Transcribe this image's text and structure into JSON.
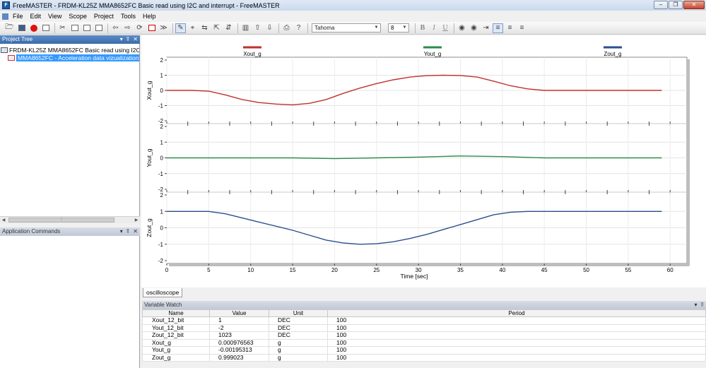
{
  "window": {
    "title": "FreeMASTER - FRDM-KL25Z MMA8652FC Basic read using I2C and interrupt - FreeMASTER",
    "app_icon_letter": "F",
    "minimize_glyph": "–",
    "restore_glyph": "❐",
    "close_glyph": "✕"
  },
  "menu": [
    "File",
    "Edit",
    "View",
    "Scope",
    "Project",
    "Tools",
    "Help"
  ],
  "toolbar": {
    "font_name": "Tahoma",
    "font_size": "8",
    "bold": "B",
    "italic": "I",
    "underline": "U"
  },
  "project_tree": {
    "title": "Project Tree",
    "header_buttons": [
      "▾",
      "⫪",
      "✕"
    ],
    "root": "FRDM-KL25Z MMA8652FC Basic read using I2C and interrupt",
    "child": "MMA8652FC - Acceleration data vizualization"
  },
  "app_commands": {
    "title": "Application Commands",
    "header_buttons": [
      "▾",
      "⫪",
      "✕"
    ]
  },
  "scope": {
    "tab_label": "oscilloscope",
    "x_label": "Time [sec]",
    "x_ticks": [
      "0",
      "5",
      "10",
      "15",
      "20",
      "25",
      "30",
      "35",
      "40",
      "45",
      "50",
      "55",
      "60"
    ],
    "legend": [
      {
        "name": "Xout_g",
        "color": "#c0312b"
      },
      {
        "name": "Yout_g",
        "color": "#2e8b4a"
      },
      {
        "name": "Zout_g",
        "color": "#2b4f8f"
      }
    ],
    "subplots": [
      {
        "ylabel": "Xout_g",
        "y_ticks": [
          "2",
          "1",
          "0",
          "-1",
          "-2"
        ],
        "color": "#c0312b"
      },
      {
        "ylabel": "Yout_g",
        "y_ticks": [
          "2",
          "1",
          "0",
          "-1",
          "-2"
        ],
        "color": "#2e8b4a"
      },
      {
        "ylabel": "Zout_g",
        "y_ticks": [
          "2",
          "1",
          "0",
          "-1",
          "-2"
        ],
        "color": "#2b4f8f"
      }
    ]
  },
  "chart_data": {
    "type": "line",
    "xlabel": "Time [sec]",
    "xlim": [
      0,
      62
    ],
    "ylim": [
      -2,
      2
    ],
    "grid": true,
    "legend_position": "top",
    "series": [
      {
        "name": "Xout_g",
        "color": "#c0312b",
        "x": [
          0,
          3,
          5,
          7,
          9,
          11,
          13,
          15,
          17,
          19,
          21,
          23,
          25,
          27,
          29,
          31,
          33,
          35,
          37,
          39,
          41,
          43,
          45,
          47,
          50,
          55,
          59
        ],
        "values": [
          0,
          0,
          -0.05,
          -0.3,
          -0.6,
          -0.8,
          -0.9,
          -0.95,
          -0.85,
          -0.6,
          -0.2,
          0.15,
          0.45,
          0.7,
          0.88,
          0.97,
          1.0,
          0.98,
          0.88,
          0.6,
          0.3,
          0.1,
          0.0,
          0,
          0,
          0,
          0
        ]
      },
      {
        "name": "Yout_g",
        "color": "#2e8b4a",
        "x": [
          0,
          5,
          10,
          15,
          20,
          25,
          30,
          35,
          40,
          45,
          50,
          55,
          59
        ],
        "values": [
          0,
          0,
          0,
          0,
          -0.05,
          0,
          0.05,
          0.12,
          0.08,
          0,
          0,
          0,
          0
        ]
      },
      {
        "name": "Zout_g",
        "color": "#2b4f8f",
        "x": [
          0,
          5,
          7,
          9,
          11,
          13,
          15,
          17,
          19,
          21,
          23,
          25,
          27,
          29,
          31,
          33,
          35,
          37,
          39,
          41,
          43,
          45,
          50,
          55,
          59
        ],
        "values": [
          1,
          1,
          0.85,
          0.6,
          0.35,
          0.1,
          -0.15,
          -0.45,
          -0.75,
          -0.92,
          -1.0,
          -0.97,
          -0.85,
          -0.65,
          -0.4,
          -0.1,
          0.2,
          0.5,
          0.8,
          0.95,
          1.0,
          1.0,
          1.0,
          1.0,
          1.0
        ]
      }
    ]
  },
  "variable_watch": {
    "title": "Variable Watch",
    "header_buttons": [
      "▾",
      "⫪"
    ],
    "columns": [
      "Name",
      "Value",
      "Unit",
      "Period"
    ],
    "rows": [
      [
        "Xout_12_bit",
        "1",
        "DEC",
        "100"
      ],
      [
        "Yout_12_bit",
        "-2",
        "DEC",
        "100"
      ],
      [
        "Zout_12_bit",
        "1023",
        "DEC",
        "100"
      ],
      [
        "Xout_g",
        "0.000976563",
        "g",
        "100"
      ],
      [
        "Yout_g",
        "-0.00195313",
        "g",
        "100"
      ],
      [
        "Zout_g",
        "0.999023",
        "g",
        "100"
      ]
    ]
  }
}
